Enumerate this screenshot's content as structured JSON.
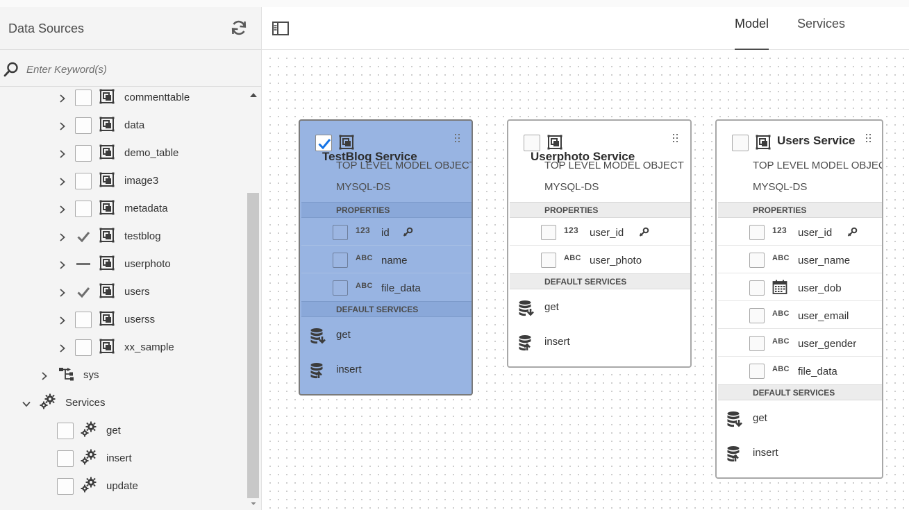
{
  "left_panel": {
    "title": "Data Sources",
    "search_placeholder": "Enter Keyword(s)",
    "tables": [
      {
        "label": "commenttable",
        "state": "unchecked"
      },
      {
        "label": "data",
        "state": "unchecked"
      },
      {
        "label": "demo_table",
        "state": "unchecked"
      },
      {
        "label": "image3",
        "state": "unchecked"
      },
      {
        "label": "metadata",
        "state": "unchecked"
      },
      {
        "label": "testblog",
        "state": "checked"
      },
      {
        "label": "userphoto",
        "state": "partial"
      },
      {
        "label": "users",
        "state": "checked"
      },
      {
        "label": "userss",
        "state": "unchecked"
      },
      {
        "label": "xx_sample",
        "state": "unchecked"
      }
    ],
    "sys_label": "sys",
    "services_label": "Services",
    "services": [
      {
        "label": "get"
      },
      {
        "label": "insert"
      },
      {
        "label": "update"
      }
    ]
  },
  "tabs": [
    {
      "label": "Model",
      "active": true
    },
    {
      "label": "Services",
      "active": false
    }
  ],
  "cards": [
    {
      "title": "TestBlog Service",
      "subtitle": "TOP LEVEL MODEL OBJECT",
      "datasource": "MYSQL-DS",
      "selected": true,
      "checked": true,
      "properties_label": "PROPERTIES",
      "properties": [
        {
          "type": "123",
          "name": "id",
          "key": true
        },
        {
          "type": "ABC",
          "name": "name"
        },
        {
          "type": "ABC",
          "name": "file_data"
        }
      ],
      "services_label": "DEFAULT SERVICES",
      "services": [
        {
          "name": "get"
        },
        {
          "name": "insert"
        }
      ]
    },
    {
      "title": "Userphoto Service",
      "subtitle": "TOP LEVEL MODEL OBJECT",
      "datasource": "MYSQL-DS",
      "selected": false,
      "checked": false,
      "properties_label": "PROPERTIES",
      "properties": [
        {
          "type": "123",
          "name": "user_id",
          "key": true
        },
        {
          "type": "ABC",
          "name": "user_photo"
        }
      ],
      "services_label": "DEFAULT SERVICES",
      "services": [
        {
          "name": "get"
        },
        {
          "name": "insert"
        }
      ]
    },
    {
      "title": "Users Service",
      "subtitle": "TOP LEVEL MODEL OBJECT",
      "datasource": "MYSQL-DS",
      "selected": false,
      "checked": false,
      "properties_label": "PROPERTIES",
      "properties": [
        {
          "type": "123",
          "name": "user_id",
          "key": true
        },
        {
          "type": "ABC",
          "name": "user_name"
        },
        {
          "type": "calendar",
          "name": "user_dob"
        },
        {
          "type": "ABC",
          "name": "user_email"
        },
        {
          "type": "ABC",
          "name": "user_gender"
        },
        {
          "type": "ABC",
          "name": "file_data"
        }
      ],
      "services_label": "DEFAULT SERVICES",
      "services": [
        {
          "name": "get"
        },
        {
          "name": "insert"
        }
      ]
    }
  ],
  "colors": {
    "selected_card_bg": "#98b4e2",
    "check_blue": "#1473e6",
    "panel_bg": "#f4f4f4"
  }
}
